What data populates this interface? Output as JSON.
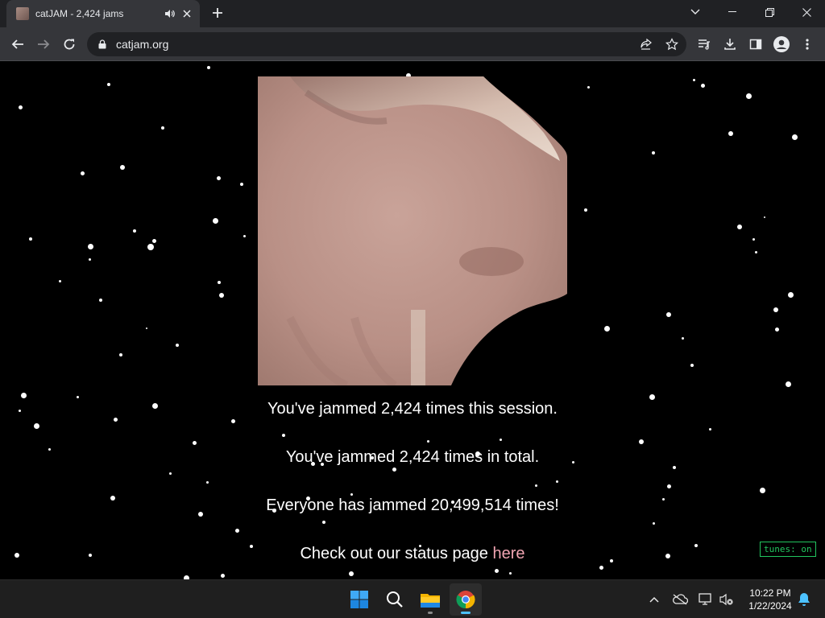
{
  "browser": {
    "tab_title": "catJAM - 2,424 jams",
    "url": "catjam.org"
  },
  "page": {
    "session_msg": "You've jammed 2,424 times this session.",
    "total_msg": "You've jammed 2,424 times in total.",
    "everyone_msg": "Everyone has jammed 20,499,514 times!",
    "status_prefix": "Check out our status page ",
    "status_link": "here",
    "tunes_label": "tunes: on"
  },
  "taskbar": {
    "time": "10:22 PM",
    "date": "1/22/2024"
  },
  "colors": {
    "link": "#f1a5b2",
    "tunes": "#22c55e",
    "chrome_bg": "#202124",
    "toolbar_bg": "#35363a"
  }
}
